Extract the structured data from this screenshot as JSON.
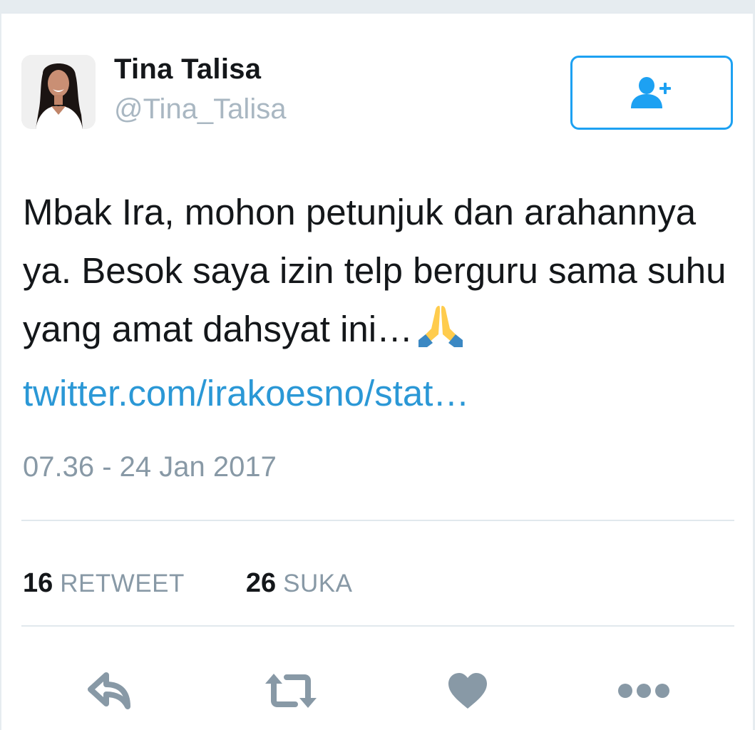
{
  "user": {
    "display_name": "Tina Talisa",
    "screen_name": "@Tina_Talisa"
  },
  "follow_button": {
    "icon": "follow-user-icon"
  },
  "tweet": {
    "text_before_link": "Mbak Ira, mohon petunjuk dan arahannya ya. Besok saya izin telp berguru sama suhu yang amat dahsyat ini…",
    "emoji": "folded-hands-emoji",
    "link_text": "twitter.com/irakoesno/stat…",
    "timestamp": "07.36 - 24 Jan 2017"
  },
  "stats": {
    "retweet_count": "16",
    "retweet_label": "RETWEET",
    "like_count": "26",
    "like_label": "SUKA"
  },
  "actions": {
    "reply_icon": "reply-icon",
    "retweet_icon": "retweet-icon",
    "like_icon": "heart-icon",
    "more_icon": "more-icon"
  },
  "colors": {
    "accent": "#1da1f2",
    "link": "#2b98d6",
    "secondary_text": "#8899a6",
    "action_icon": "#8899a6",
    "emoji_yellow": "#ffcc4d",
    "emoji_blue": "#3b88c3"
  }
}
